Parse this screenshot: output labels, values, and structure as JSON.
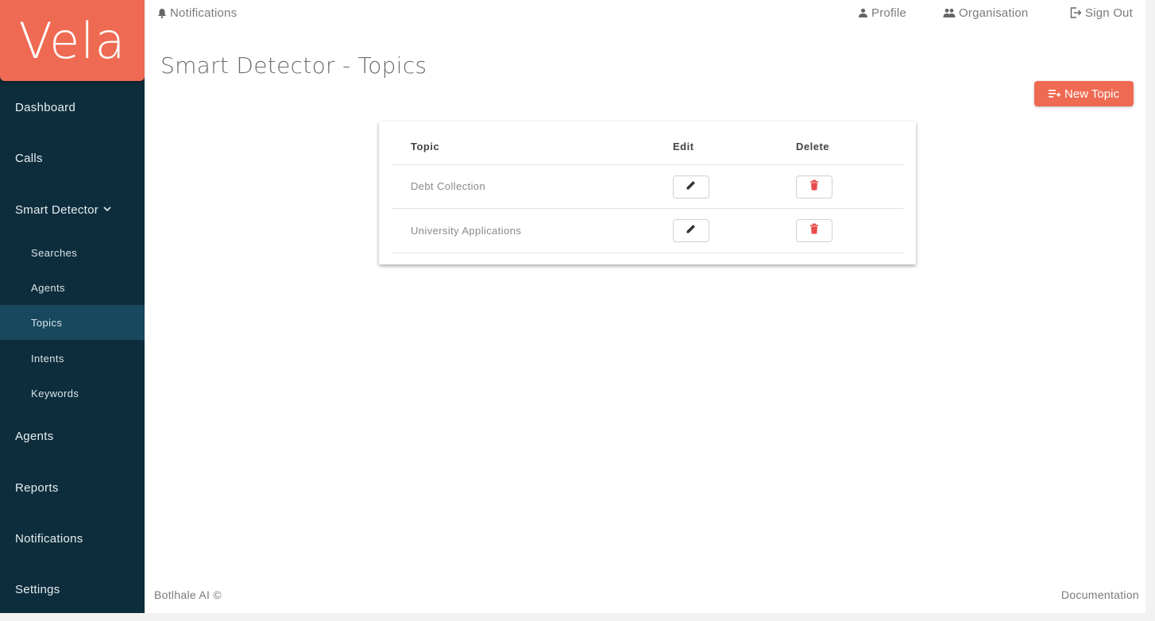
{
  "brand": {
    "logo_text": "Vela",
    "accent_color": "#ee6a52",
    "sidebar_color": "#0e2d3c"
  },
  "sidebar": {
    "items": [
      {
        "label": "Dashboard"
      },
      {
        "label": "Calls"
      },
      {
        "label": "Smart Detector",
        "expanded": true,
        "children": [
          {
            "label": "Searches"
          },
          {
            "label": "Agents"
          },
          {
            "label": "Topics",
            "active": true
          },
          {
            "label": "Intents"
          },
          {
            "label": "Keywords"
          }
        ]
      },
      {
        "label": "Agents"
      },
      {
        "label": "Reports"
      },
      {
        "label": "Notifications"
      },
      {
        "label": "Settings"
      }
    ]
  },
  "topbar": {
    "notifications": "Notifications",
    "profile": "Profile",
    "organisation": "Organisation",
    "sign_out": "Sign Out"
  },
  "page": {
    "title": "Smart Detector - Topics",
    "new_topic_label": "New Topic"
  },
  "table": {
    "headers": {
      "topic": "Topic",
      "edit": "Edit",
      "delete": "Delete"
    },
    "rows": [
      {
        "topic": "Debt Collection"
      },
      {
        "topic": "University Applications"
      }
    ]
  },
  "footer": {
    "left": "Botlhale AI ©",
    "right": "Documentation"
  },
  "icons": {
    "notifications": "bell-icon",
    "profile": "person-icon",
    "organisation": "people-icon",
    "sign_out": "logout-icon",
    "new_topic": "playlist-add-icon",
    "edit": "pencil-icon",
    "delete": "trash-icon",
    "expand": "chevron-down-icon"
  }
}
